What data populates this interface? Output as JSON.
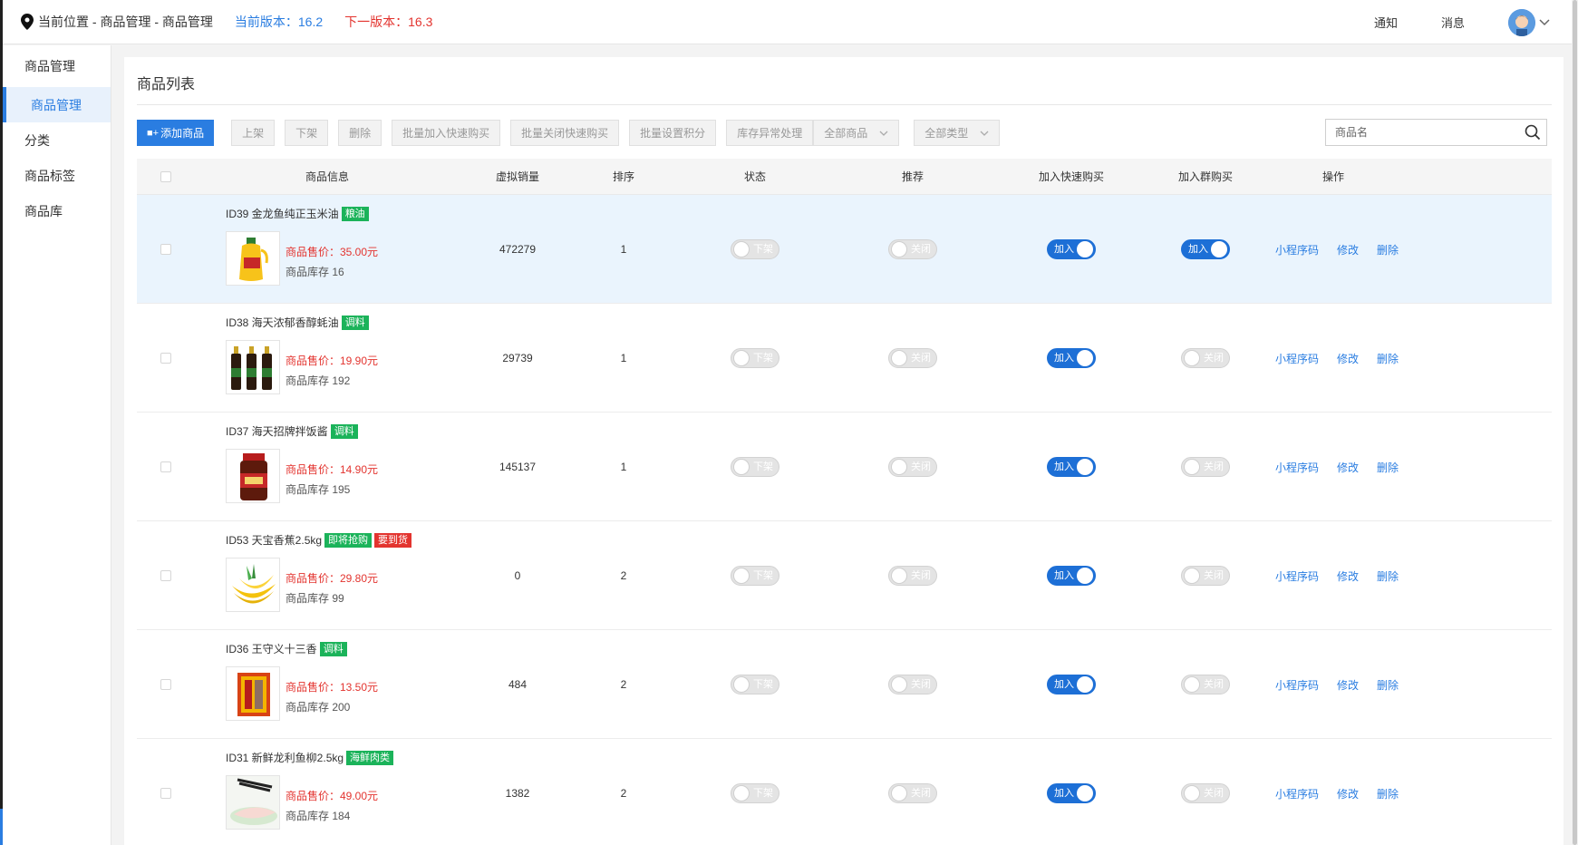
{
  "header": {
    "location": "当前位置 - 商品管理 - 商品管理",
    "current_version": "当前版本：16.2",
    "next_version": "下一版本：16.3",
    "notify": "通知",
    "message": "消息"
  },
  "sidebar": {
    "items": [
      {
        "label": "商品管理"
      },
      {
        "label": "商品管理"
      },
      {
        "label": "分类"
      },
      {
        "label": "商品标签"
      },
      {
        "label": "商品库"
      }
    ]
  },
  "main": {
    "title": "商品列表"
  },
  "toolbar": {
    "add": "添加商品",
    "on_shelf": "上架",
    "off_shelf": "下架",
    "delete": "删除",
    "batch_add_quick": "批量加入快速购买",
    "batch_close_quick": "批量关闭快速购买",
    "batch_points": "批量设置积分",
    "stock_exception": "库存异常处理",
    "filter_goods": "全部商品",
    "filter_type": "全部类型"
  },
  "search": {
    "placeholder": "商品名"
  },
  "table": {
    "columns": [
      "商品信息",
      "虚拟销量",
      "排序",
      "状态",
      "推荐",
      "加入快速购买",
      "加入群购买",
      "操作"
    ],
    "price_prefix": "商品售价：",
    "stock_prefix": "商品库存",
    "ops": [
      "小程序码",
      "修改",
      "删除"
    ],
    "rows": [
      {
        "name": "ID39 金龙鱼纯正玉米油",
        "tags": [
          {
            "text": "粮油",
            "color": "green"
          }
        ],
        "price": "商品售价：35.00元",
        "stock": "商品库存 16",
        "sales": "472279",
        "sort": "1",
        "status": "下架",
        "recommend": "关闭",
        "quick": "加入",
        "quick_on": true,
        "group": "加入",
        "group_on": true,
        "highlight": true,
        "img": "oil"
      },
      {
        "name": "ID38 海天浓郁香醇蚝油",
        "tags": [
          {
            "text": "调料",
            "color": "green"
          }
        ],
        "price": "商品售价：19.90元",
        "stock": "商品库存 192",
        "sales": "29739",
        "sort": "1",
        "status": "下架",
        "recommend": "关闭",
        "quick": "加入",
        "quick_on": true,
        "group": "关闭",
        "group_on": false,
        "highlight": false,
        "img": "bottles"
      },
      {
        "name": "ID37 海天招牌拌饭酱",
        "tags": [
          {
            "text": "调料",
            "color": "green"
          }
        ],
        "price": "商品售价：14.90元",
        "stock": "商品库存 195",
        "sales": "145137",
        "sort": "1",
        "status": "下架",
        "recommend": "关闭",
        "quick": "加入",
        "quick_on": true,
        "group": "关闭",
        "group_on": false,
        "highlight": false,
        "img": "jar"
      },
      {
        "name": "ID53 天宝香蕉2.5kg",
        "tags": [
          {
            "text": "即将抢购",
            "color": "green"
          },
          {
            "text": "要到货",
            "color": "red"
          }
        ],
        "price": "商品售价：29.80元",
        "stock": "商品库存 99",
        "sales": "0",
        "sort": "2",
        "status": "下架",
        "recommend": "关闭",
        "quick": "加入",
        "quick_on": true,
        "group": "关闭",
        "group_on": false,
        "highlight": false,
        "img": "banana"
      },
      {
        "name": "ID36 王守义十三香",
        "tags": [
          {
            "text": "调料",
            "color": "green"
          }
        ],
        "price": "商品售价：13.50元",
        "stock": "商品库存 200",
        "sales": "484",
        "sort": "2",
        "status": "下架",
        "recommend": "关闭",
        "quick": "加入",
        "quick_on": true,
        "group": "关闭",
        "group_on": false,
        "highlight": false,
        "img": "spice"
      },
      {
        "name": "ID31 新鲜龙利鱼柳2.5kg",
        "tags": [
          {
            "text": "海鲜肉类",
            "color": "green"
          }
        ],
        "price": "商品售价：49.00元",
        "stock": "商品库存 184",
        "sales": "1382",
        "sort": "2",
        "status": "下架",
        "recommend": "关闭",
        "quick": "加入",
        "quick_on": true,
        "group": "关闭",
        "group_on": false,
        "highlight": false,
        "img": "fish"
      }
    ]
  },
  "colors": {
    "accent": "#2a7de1",
    "toggle_on": "#1d6fd6",
    "price": "#e3342f",
    "tag_green": "#1bb35a",
    "tag_red": "#e3342f"
  }
}
